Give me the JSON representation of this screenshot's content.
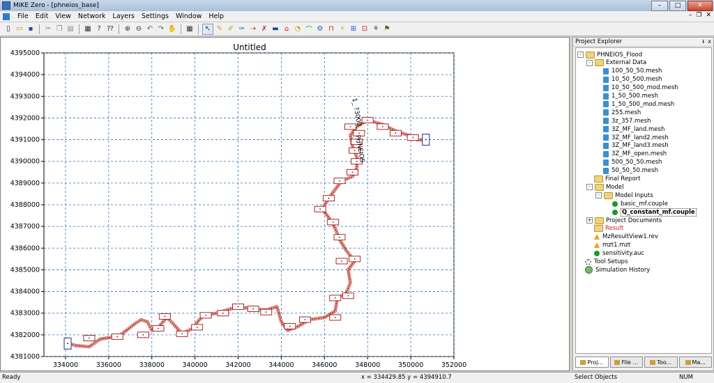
{
  "window": {
    "title": "MIKE Zero - [phneios_base]"
  },
  "menu": [
    "File",
    "Edit",
    "View",
    "Network",
    "Layers",
    "Settings",
    "Window",
    "Help"
  ],
  "toolbar_icons": [
    "new-icon",
    "open-icon",
    "save-icon",
    "cut-icon",
    "copy-icon",
    "paste-icon",
    "print-icon",
    "help-icon",
    "context-help-icon",
    "zoom-in-icon",
    "zoom-out-icon",
    "zoom-prev-icon",
    "zoom-next-icon",
    "pan-icon",
    "grid-icon",
    "select-icon",
    "add-point-icon",
    "add-branch-icon",
    "insert-icon",
    "connect-icon",
    "delete-icon",
    "structure-icon",
    "weir-icon",
    "culvert-icon",
    "bridge-icon",
    "pump-icon",
    "gate-icon",
    "dambreak-icon",
    "cross-section-icon",
    "boundary-icon",
    "tool-a-icon",
    "tool-b-icon"
  ],
  "chart_data": {
    "type": "scatter",
    "title": "Untitled",
    "x_ticks": [
      "334000",
      "336000",
      "338000",
      "340000",
      "342000",
      "344000",
      "346000",
      "348000",
      "350000",
      "352000"
    ],
    "y_ticks": [
      "4381000",
      "4382000",
      "4383000",
      "4384000",
      "4385000",
      "4386000",
      "4387000",
      "4388000",
      "4389000",
      "4390000",
      "4391000",
      "4392000",
      "4393000",
      "4394000",
      "4395000"
    ],
    "xlim": [
      333000,
      352000
    ],
    "ylim": [
      4381000,
      4395000
    ],
    "grid": true,
    "annotation": "1_ ?3000",
    "annotation_sub": "PHNEIOS",
    "river_path": [
      [
        334000,
        4381650
      ],
      [
        334500,
        4381500
      ],
      [
        335100,
        4381450
      ],
      [
        335600,
        4381800
      ],
      [
        336500,
        4381950
      ],
      [
        337200,
        4382500
      ],
      [
        337500,
        4382700
      ],
      [
        337800,
        4382600
      ],
      [
        338000,
        4382200
      ],
      [
        338300,
        4382350
      ],
      [
        338700,
        4382800
      ],
      [
        339000,
        4382500
      ],
      [
        339400,
        4382050
      ],
      [
        339900,
        4382300
      ],
      [
        340200,
        4382700
      ],
      [
        340500,
        4382900
      ],
      [
        341000,
        4383000
      ],
      [
        341500,
        4383150
      ],
      [
        342000,
        4383300
      ],
      [
        342600,
        4383200
      ],
      [
        343300,
        4383150
      ],
      [
        343800,
        4383300
      ],
      [
        344000,
        4382600
      ],
      [
        344300,
        4382200
      ],
      [
        344800,
        4382400
      ],
      [
        345300,
        4382700
      ],
      [
        346000,
        4382800
      ],
      [
        346500,
        4383100
      ],
      [
        346600,
        4383700
      ],
      [
        347000,
        4383900
      ],
      [
        347200,
        4384400
      ],
      [
        347100,
        4385000
      ],
      [
        347400,
        4385400
      ],
      [
        347000,
        4385900
      ],
      [
        346700,
        4386400
      ],
      [
        346500,
        4386900
      ],
      [
        346200,
        4387400
      ],
      [
        345900,
        4387800
      ],
      [
        346200,
        4388300
      ],
      [
        346500,
        4388700
      ],
      [
        346800,
        4389100
      ],
      [
        347300,
        4389300
      ],
      [
        347500,
        4389700
      ],
      [
        347500,
        4390200
      ],
      [
        347300,
        4390700
      ],
      [
        347200,
        4391200
      ],
      [
        347500,
        4391600
      ],
      [
        348000,
        4391900
      ],
      [
        348700,
        4391700
      ],
      [
        349300,
        4391400
      ],
      [
        349900,
        4391200
      ],
      [
        350300,
        4391000
      ],
      [
        350800,
        4390950
      ]
    ],
    "cross_sections": [
      [
        335100,
        4381850
      ],
      [
        336400,
        4381920
      ],
      [
        337600,
        4382000
      ],
      [
        338300,
        4382300
      ],
      [
        338600,
        4382850
      ],
      [
        339400,
        4382050
      ],
      [
        340100,
        4382350
      ],
      [
        340500,
        4382900
      ],
      [
        341300,
        4383000
      ],
      [
        342000,
        4383300
      ],
      [
        342700,
        4383200
      ],
      [
        343300,
        4383050
      ],
      [
        344400,
        4382400
      ],
      [
        345100,
        4382700
      ],
      [
        346500,
        4382800
      ],
      [
        346500,
        4383700
      ],
      [
        347100,
        4383800
      ],
      [
        347400,
        4385500
      ],
      [
        346800,
        4385400
      ],
      [
        346700,
        4386500
      ],
      [
        346400,
        4387200
      ],
      [
        345800,
        4387800
      ],
      [
        346200,
        4388300
      ],
      [
        346700,
        4389100
      ],
      [
        347300,
        4389500
      ],
      [
        347500,
        4390000
      ],
      [
        347400,
        4390500
      ],
      [
        347500,
        4390900
      ],
      [
        347200,
        4391600
      ],
      [
        347600,
        4391300
      ],
      [
        348000,
        4391900
      ],
      [
        348700,
        4391600
      ],
      [
        349300,
        4391300
      ],
      [
        350100,
        4391100
      ]
    ],
    "boundaries": [
      [
        334100,
        4381600
      ],
      [
        350700,
        4391000
      ]
    ]
  },
  "explorer": {
    "title": "Project Explorer",
    "pin": "ᵻ",
    "close": "x",
    "tree": [
      {
        "label": "PHNEIOS_Flood",
        "level": 0,
        "icon": "folder",
        "expander": "-"
      },
      {
        "label": "External Data",
        "level": 1,
        "icon": "folder",
        "expander": "-"
      },
      {
        "label": "100_50_50.mesh",
        "level": 2,
        "icon": "mesh"
      },
      {
        "label": "10_50_500.mesh",
        "level": 2,
        "icon": "mesh"
      },
      {
        "label": "10_50_500_mod.mesh",
        "level": 2,
        "icon": "mesh"
      },
      {
        "label": "1_50_500.mesh",
        "level": 2,
        "icon": "mesh"
      },
      {
        "label": "1_50_500_mod.mesh",
        "level": 2,
        "icon": "mesh"
      },
      {
        "label": "255.mesh",
        "level": 2,
        "icon": "mesh"
      },
      {
        "label": "3z_357.mesh",
        "level": 2,
        "icon": "mesh"
      },
      {
        "label": "3Z_MF_land.mesh",
        "level": 2,
        "icon": "mesh"
      },
      {
        "label": "3Z_MF_land2.mesh",
        "level": 2,
        "icon": "mesh"
      },
      {
        "label": "3Z_MF_land3.mesh",
        "level": 2,
        "icon": "mesh"
      },
      {
        "label": "3Z_MF_open.mesh",
        "level": 2,
        "icon": "mesh"
      },
      {
        "label": "500_50_50.mesh",
        "level": 2,
        "icon": "mesh"
      },
      {
        "label": "50_50_50.mesh",
        "level": 2,
        "icon": "mesh"
      },
      {
        "label": "Final Report",
        "level": 1,
        "icon": "folder"
      },
      {
        "label": "Model",
        "level": 1,
        "icon": "folder",
        "expander": "-"
      },
      {
        "label": "Model Inputs",
        "level": 2,
        "icon": "folder",
        "expander": "-"
      },
      {
        "label": "basic_mf.couple",
        "level": 3,
        "icon": "green"
      },
      {
        "label": "Q_constant_mf.couple",
        "level": 3,
        "icon": "green",
        "selected": true
      },
      {
        "label": "Project Documents",
        "level": 1,
        "icon": "folder",
        "expander": "+"
      },
      {
        "label": "Result",
        "level": 1,
        "icon": "folder",
        "red": true
      },
      {
        "label": "MzResultView1.rev",
        "level": 1,
        "icon": "orange"
      },
      {
        "label": "mzt1.mzt",
        "level": 1,
        "icon": "orange"
      },
      {
        "label": "sensitivity.auc",
        "level": 1,
        "icon": "green"
      },
      {
        "label": "Tool Setups",
        "level": 0,
        "icon": "gear"
      },
      {
        "label": "Simulation History",
        "level": 0,
        "icon": "hist"
      }
    ],
    "tabs": [
      "Proj...",
      "File ...",
      "Too...",
      "Ma..."
    ]
  },
  "status": {
    "left": "Ready",
    "coords": "x = 334429.85  y = 4394910.7",
    "mode": "Select Objects",
    "num": "NUM"
  }
}
